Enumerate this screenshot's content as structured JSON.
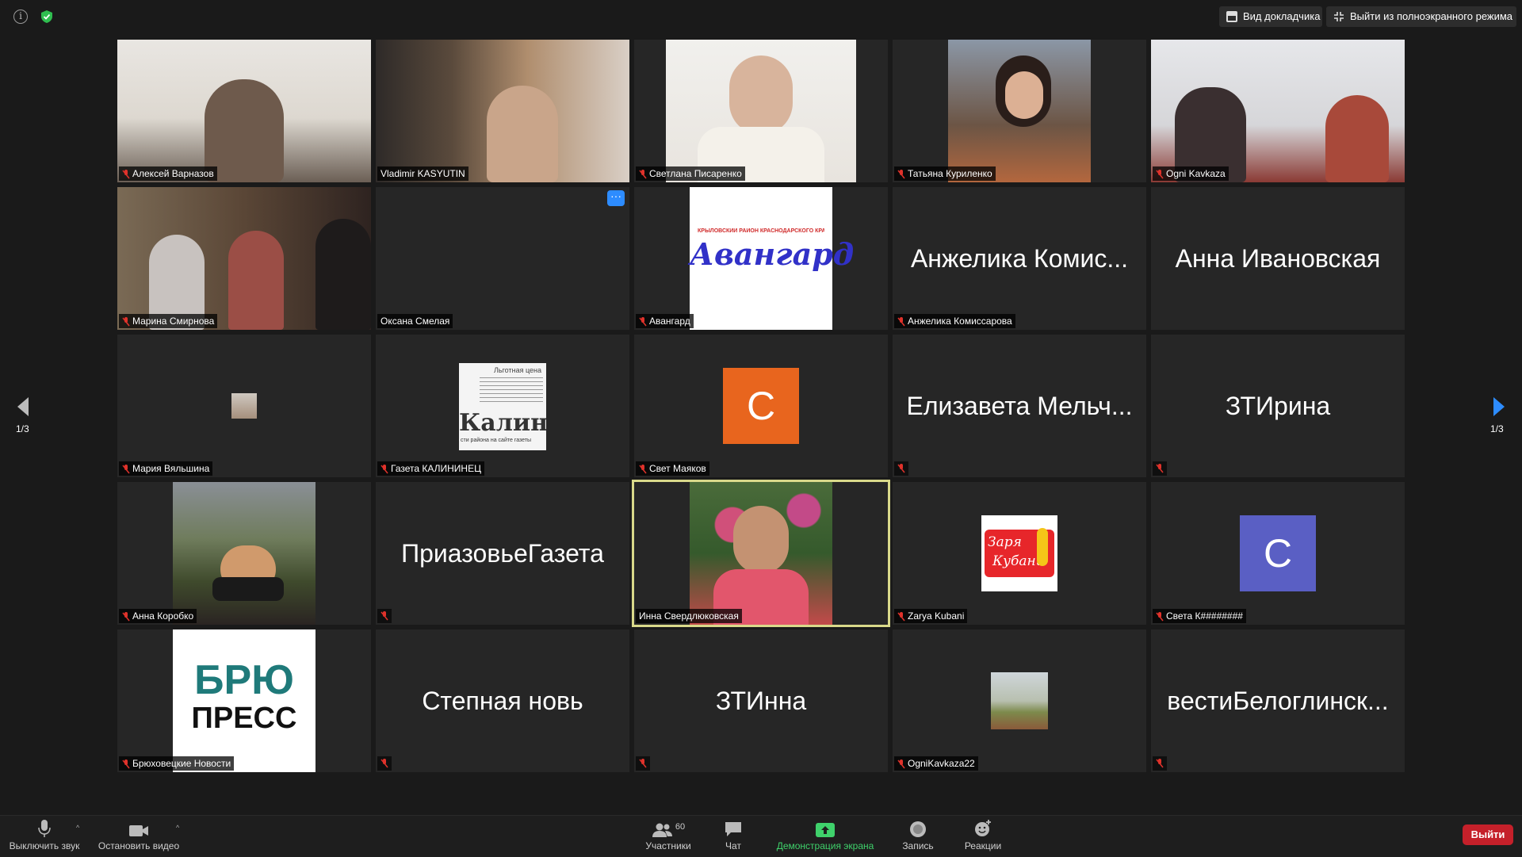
{
  "topbar": {
    "speaker_view": "Вид докладчика",
    "exit_fullscreen": "Выйти из полноэкранного режима"
  },
  "navigation": {
    "page_indicator": "1/3"
  },
  "participants": [
    {
      "name": "Алексей Варназов",
      "muted": true
    },
    {
      "name": "Vladimir KASYUTIN",
      "muted": false
    },
    {
      "name": "Светлана Писаренко",
      "muted": true
    },
    {
      "name": "Татьяна Куриленко",
      "muted": true
    },
    {
      "name": "Ogni Kavkaza",
      "muted": true
    },
    {
      "name": "Марина Смирнова",
      "muted": true
    },
    {
      "name": "Оксана Смелая",
      "muted": false
    },
    {
      "name": "Авангард",
      "muted": true,
      "logo_top": "КРЫЛОВСКИЙ РАЙОН КРАСНОДАРСКОГО КРАЯ",
      "logo_main": "Авангард"
    },
    {
      "name": "Анжелика Комиссарова",
      "muted": true,
      "display": "Анжелика Комис..."
    },
    {
      "name": "Анна Ивановская",
      "display": "Анна Ивановская"
    },
    {
      "name": "Мария Вяльшина",
      "muted": true
    },
    {
      "name": "Газета КАЛИНИНЕЦ",
      "muted": true,
      "logo_top": "Льготная цена",
      "logo_main": "Калини",
      "logo_bottom": "сти района на сайте газеты"
    },
    {
      "name": "Свет Маяков",
      "muted": true,
      "avatar": "С"
    },
    {
      "display": "Елизавета Мельч...",
      "muted": true
    },
    {
      "display": "ЗТИрина",
      "muted": true
    },
    {
      "name": "Анна Коробко",
      "muted": true
    },
    {
      "display": "ПриазовьеГазета",
      "muted": true
    },
    {
      "name": "Инна Свердлюковская",
      "muted": false,
      "active": true
    },
    {
      "name": "Zarya Kubani",
      "muted": true,
      "logo_line1": "Заря",
      "logo_line2": "Кубани"
    },
    {
      "name": "Света К########",
      "muted": true,
      "avatar": "С"
    },
    {
      "name": "Брюховецкие Новости",
      "muted": true,
      "logo_line1": "БРЮ",
      "logo_line2": "ПРЕСС"
    },
    {
      "display": "Степная новь",
      "muted": true
    },
    {
      "display": "ЗТИнна",
      "muted": true
    },
    {
      "name": "OgniKavkaza22",
      "muted": true
    },
    {
      "display": "вестиБелоглинск...",
      "muted": true
    }
  ],
  "toolbar": {
    "mute": "Выключить звук",
    "stop_video": "Остановить видео",
    "participants": "Участники",
    "participants_count": "60",
    "chat": "Чат",
    "share_screen": "Демонстрация экрана",
    "record": "Запись",
    "reactions": "Реакции",
    "leave": "Выйти"
  },
  "colors": {
    "accent_blue": "#2d8cff",
    "share_green": "#3fd16b",
    "leave_red": "#c5202a",
    "avatar_orange": "#e8651e",
    "avatar_purple": "#5a5fc4",
    "active_border": "#d9d98a"
  }
}
